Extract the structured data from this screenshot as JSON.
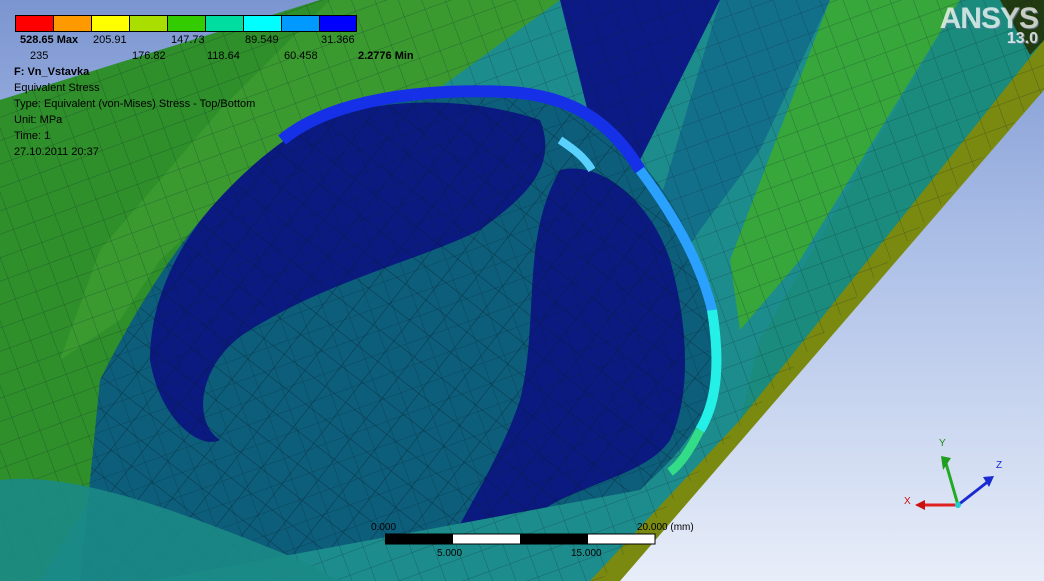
{
  "logo": {
    "text": "ANSYS",
    "version": "13.0"
  },
  "legend": {
    "colors": [
      "#ff0000",
      "#ff9900",
      "#ffff00",
      "#aadd00",
      "#33cc00",
      "#00dda0",
      "#00ffff",
      "#0099ff",
      "#0000ff"
    ],
    "max_label": "528.65 Max",
    "min_label": "2.2776 Min",
    "top_values": [
      "205.91",
      "147.73",
      "89.549",
      "31.366"
    ],
    "bottom_values": [
      "235",
      "176.82",
      "118.64",
      "60.458"
    ]
  },
  "info": {
    "title": "F: Vn_Vstavka",
    "result": "Equivalent Stress",
    "type": "Type: Equivalent (von-Mises) Stress - Top/Bottom",
    "unit": "Unit: MPa",
    "time": "Time: 1",
    "date": "27.10.2011 20:37"
  },
  "scale": {
    "top_labels": [
      "0.000",
      "20.000 (mm)"
    ],
    "bottom_labels": [
      "5.000",
      "15.000"
    ]
  },
  "triad": {
    "x": "X",
    "y": "Y",
    "z": "Z"
  }
}
